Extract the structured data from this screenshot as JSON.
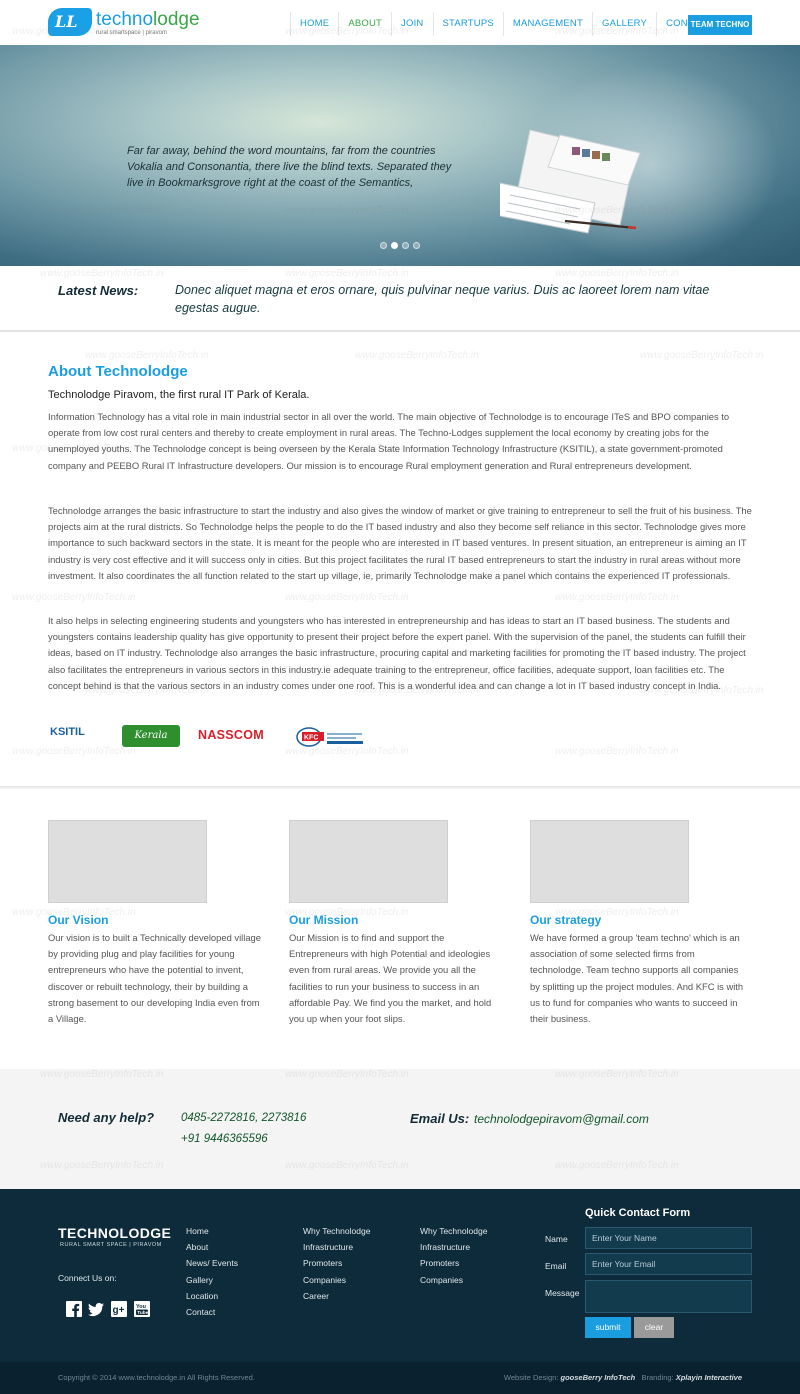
{
  "brand": {
    "logo_mark": "LL",
    "name_part1": "techno",
    "name_part2": "lodge",
    "tagline": "rural smartspace  |  piravom"
  },
  "nav": {
    "items": [
      "HOME",
      "ABOUT",
      "JOIN",
      "STARTUPS",
      "MANAGEMENT",
      "GALLERY",
      "CONTACT"
    ],
    "active": "ABOUT",
    "cta": "TEAM TECHNO"
  },
  "hero": {
    "text": "Far far away, behind the word mountains, far from the countries Vokalia and Consonantia, there live the blind texts. Separated they live in Bookmarksgrove right at the coast of the Semantics,",
    "slide_count": 4,
    "active_slide": 2
  },
  "news": {
    "label": "Latest News:",
    "text": "Donec aliquet magna et eros ornare, quis pulvinar neque varius. Duis ac laoreet lorem nam vitae egestas augue."
  },
  "about": {
    "title": "About Technolodge",
    "subtitle": "Technolodge Piravom, the first rural IT Park of Kerala.",
    "p1": "Information Technology has a vital role in main industrial sector in all over the world. The main objective of Technolodge is to encourage ITeS and BPO companies to operate from low cost rural centers and thereby to create employment in rural areas. The Techno-Lodges supplement the local economy by creating jobs for the unemployed youths. The Technolodge concept is being overseen by the Kerala State Information Technology Infrastructure (KSITIL), a state government-promoted company and PEEBO Rural IT Infrastructure developers. Our mission is to encourage Rural employment generation and Rural entrepreneurs development.",
    "p2": "Technolodge arranges the basic infrastructure to start the industry and also gives the window of market or give training to entrepreneur to sell the fruit of his business. The projects aim at the rural districts. So Technolodge helps the people to do the IT based industry and also they become self reliance in this sector. Technolodge gives more importance to such backward sectors in the state. It is meant for the people who are interested in IT based ventures. In present situation, an entrepreneur is aiming an IT industry is very cost effective and it will success only in cities. But this project facilitates the rural IT based entrepreneurs to start the industry in rural areas without more investment. It also coordinates the all function related to the start up village, ie, primarily Technolodge make a panel which contains the experienced IT professionals.",
    "p3": "It also helps in selecting engineering students and youngsters who has interested in entrepreneurship and has ideas to start an IT based business. The students and youngsters contains leadership quality has give opportunity to present their project before the expert panel. With the supervision of the panel, the students can fulfill their ideas, based on IT industry. Technolodge also arranges the basic infrastructure, procuring capital and marketing facilities for promoting the IT based industry. The project also facilitates the entrepreneurs in various sectors in this industry.ie adequate training to the entrepreneur, office facilities, adequate support, loan facilities etc. The concept behind is that the various sectors in an industry comes under one roof. This is a wonderful idea and can change a lot in IT based industry concept in India.",
    "partners": [
      "KSITIL",
      "Kerala",
      "NASSCOM",
      "KFC"
    ]
  },
  "features": [
    {
      "title": "Our Vision",
      "text": "Our vision is to built a Technically developed village by providing plug and play facilities for young entrepreneurs who have the potential to invent, discover or rebuilt technology, their by building a strong basement to our developing India even from a Village."
    },
    {
      "title": "Our Mission",
      "text": "Our Mission is to find and support the Entrepreneurs with high Potential and ideologies even from rural areas. We provide you all the facilities to run your business to success in an affordable Pay. We find you the market, and hold you up when your foot slips."
    },
    {
      "title": "Our strategy",
      "text": "We have formed a group 'team techno' which is an association of some selected firms from technolodge. Team techno supports all companies by splitting up the project modules. And KFC is with us to fund for companies who wants to succeed in their business."
    }
  ],
  "help": {
    "label": "Need any help?",
    "phone1": "0485-2272816, 2273816",
    "phone2": "+91 9446365596",
    "email_label": "Email Us:",
    "email": "technolodgepiravom@gmail.com"
  },
  "footer": {
    "logo": "TECHNOLODGE",
    "logo_tag": "RURAL SMART SPACE  |  PIRAVOM",
    "connect": "Connect Us on:",
    "social": [
      "facebook-icon",
      "twitter-icon",
      "google-plus-icon",
      "youtube-icon"
    ],
    "col1": [
      "Home",
      "About",
      "News/ Events",
      "Gallery",
      "Location",
      "Contact"
    ],
    "col2": [
      "Why Technolodge",
      "Infrastructure",
      "Promoters",
      "Companies",
      "Career"
    ],
    "col3": [
      "Why Technolodge",
      "Infrastructure",
      "Promoters",
      "Companies"
    ],
    "form": {
      "title": "Quick Contact Form",
      "name_label": "Name",
      "name_placeholder": "Enter Your Name",
      "email_label": "Email",
      "email_placeholder": "Enter Your Email",
      "message_label": "Message",
      "submit": "submit",
      "clear": "clear"
    }
  },
  "bottom": {
    "copyright": "Copyright  © 2014   www.technolodge.in   All Rights Reserved.",
    "design_label": "Website Design:",
    "design_by": "gooseBerry InfoTech",
    "branding_label": "Branding:",
    "branding_by": "Xplayin Interactive"
  },
  "watermark": "www.gooseBerryInfoTech.in",
  "colors": {
    "accent": "#1a9ee0",
    "active_nav": "#39a845",
    "footer_bg": "#0e2b3b"
  }
}
